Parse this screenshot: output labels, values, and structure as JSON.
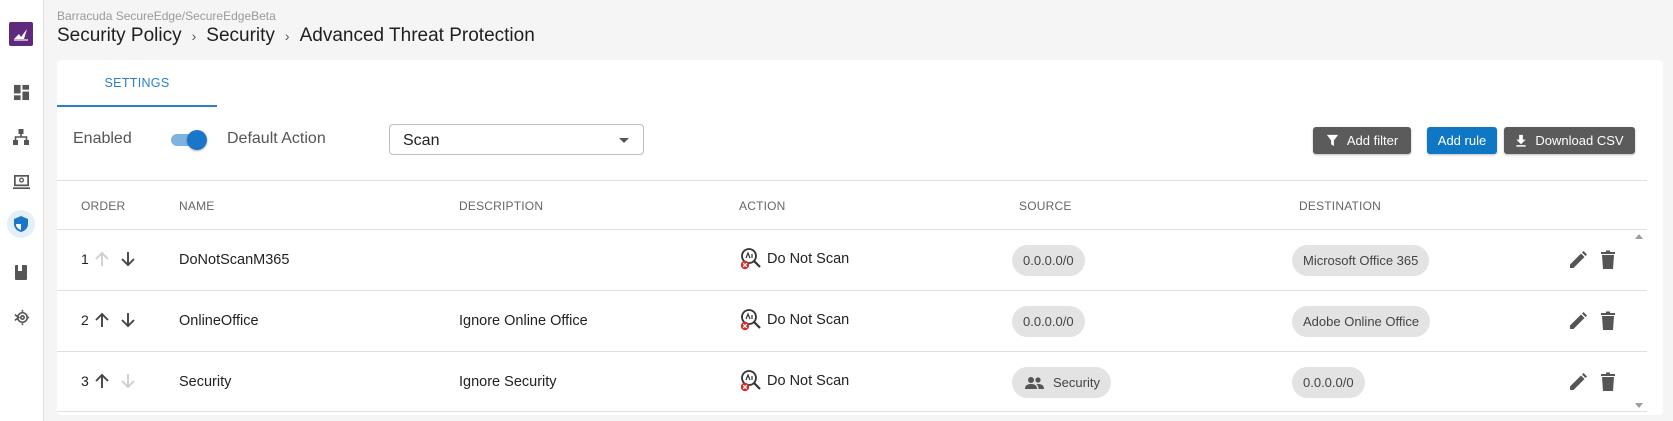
{
  "app": {
    "context": "Barracuda SecureEdge/SecureEdgeBeta",
    "breadcrumb": [
      "Security Policy",
      "Security",
      "Advanced Threat Protection"
    ]
  },
  "rail": {
    "icons": [
      "barracuda-logo-icon",
      "dashboard-icon",
      "network-icon",
      "device-icon",
      "security-shield-icon",
      "book-icon",
      "integration-settings-icon"
    ],
    "active": "security-shield-icon"
  },
  "tabs": [
    {
      "label": "SETTINGS",
      "active": true
    }
  ],
  "toolbar": {
    "enabled_label": "Enabled",
    "enabled": true,
    "default_action_label": "Default Action",
    "default_action_value": "Scan",
    "add_filter_label": "Add filter",
    "add_rule_label": "Add rule",
    "download_csv_label": "Download CSV"
  },
  "table": {
    "columns": [
      "ORDER",
      "NAME",
      "DESCRIPTION",
      "ACTION",
      "SOURCE",
      "DESTINATION"
    ],
    "rows": [
      {
        "order": "1",
        "name": "DoNotScanM365",
        "description": "",
        "action": "Do Not Scan",
        "source": "0.0.0.0/0",
        "source_icon": "",
        "destination": "Microsoft Office 365",
        "up_enabled": false,
        "down_enabled": true
      },
      {
        "order": "2",
        "name": "OnlineOffice",
        "description": "Ignore Online Office",
        "action": "Do Not Scan",
        "source": "0.0.0.0/0",
        "source_icon": "",
        "destination": "Adobe Online Office",
        "up_enabled": true,
        "down_enabled": true
      },
      {
        "order": "3",
        "name": "Security",
        "description": "Ignore Security",
        "action": "Do Not Scan",
        "source": "Security",
        "source_icon": "group-icon",
        "destination": "0.0.0.0/0",
        "up_enabled": true,
        "down_enabled": false
      }
    ]
  },
  "colors": {
    "accent": "#0f77c4",
    "brand": "#5f2a7e",
    "button_grey": "#5b5b5b",
    "chip": "#e3e3e3",
    "danger": "#d32f2f"
  }
}
